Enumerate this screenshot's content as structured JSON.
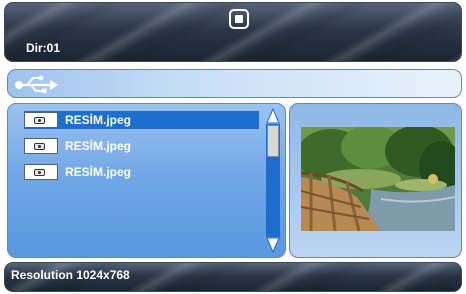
{
  "header": {
    "stop_icon": "stop-icon",
    "directory_label": "Dir:01"
  },
  "source_bar": {
    "icon": "usb-icon"
  },
  "file_list": {
    "items": [
      {
        "name": "RESİM.jpeg",
        "icon": "image-file-icon",
        "selected": true
      },
      {
        "name": "RESİM.jpeg",
        "icon": "image-file-icon",
        "selected": false
      },
      {
        "name": "RESİM.jpeg",
        "icon": "image-file-icon",
        "selected": false
      }
    ]
  },
  "preview": {
    "content": "photo-thumbnail"
  },
  "status": {
    "resolution": "Resolution 1024x768"
  },
  "colors": {
    "selection": "#1d6fcd",
    "panel_blue": "#6ea6e6",
    "header_dark": "#2b3748"
  }
}
